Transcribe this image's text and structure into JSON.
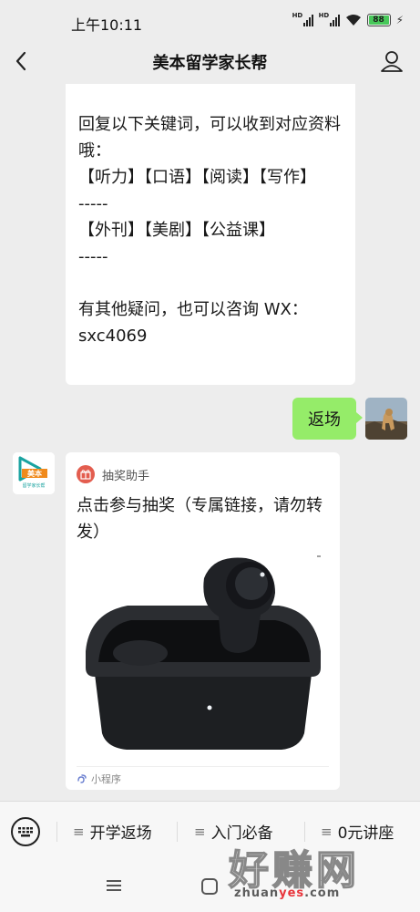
{
  "status_bar": {
    "time": "上午10:11",
    "signal_labels": [
      "HD",
      "HD"
    ],
    "battery": "88"
  },
  "nav": {
    "title": "美本留学家长帮"
  },
  "messages": {
    "received_text": "回复以下关键词，可以收到对应资料哦：\n【听力】【口语】【阅读】【写作】\n-----\n【外刊】【美剧】【公益课】\n-----\n\n有其他疑问，也可以咨询 WX：sxc4069",
    "sent_text": "返场",
    "mini_program": {
      "app_name": "抽奖助手",
      "title": "点击参与抽奖（专属链接，请勿转发）",
      "footer": "小程序"
    },
    "bot_avatar_text": "美本",
    "bot_avatar_subtext": "留学家长帮"
  },
  "bottom_menu": {
    "items": [
      {
        "label": "开学返场"
      },
      {
        "label": "入门必备"
      },
      {
        "label": "0元讲座"
      }
    ]
  },
  "watermark": {
    "big": "好赚网",
    "url_a": "zhuan",
    "url_b": "yes",
    "url_c": ".com"
  },
  "colors": {
    "sent_bubble": "#95ec69",
    "background": "#ededed",
    "gift_icon": "#e35d4f"
  }
}
